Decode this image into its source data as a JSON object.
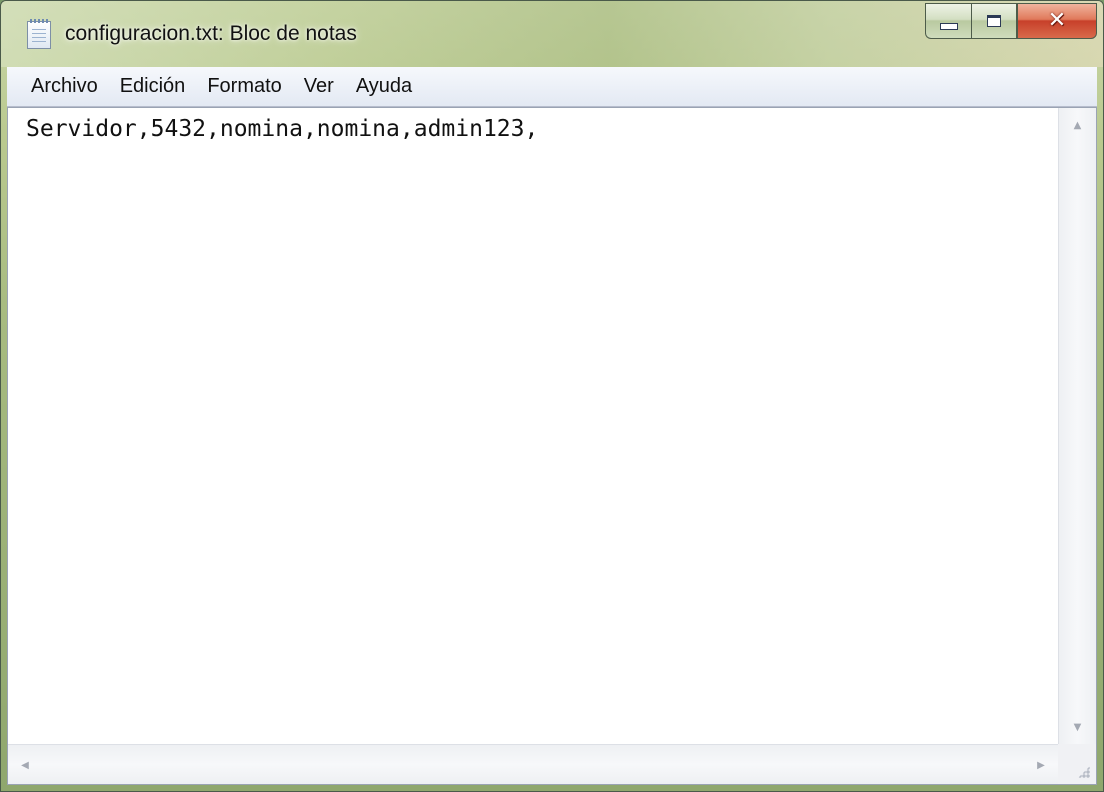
{
  "window": {
    "title": "configuracion.txt: Bloc de notas",
    "icon": "notepad-icon",
    "buttons": {
      "minimize": "minimize-icon",
      "maximize": "maximize-icon",
      "close": "close-icon"
    }
  },
  "menu": {
    "items": [
      {
        "label": "Archivo"
      },
      {
        "label": "Edición"
      },
      {
        "label": "Formato"
      },
      {
        "label": "Ver"
      },
      {
        "label": "Ayuda"
      }
    ]
  },
  "editor": {
    "content": "Servidor,5432,nomina,nomina,admin123,"
  },
  "colors": {
    "close_button": "#c7402a",
    "menubar": "#e3e9f3",
    "editor_background": "#ffffff"
  }
}
